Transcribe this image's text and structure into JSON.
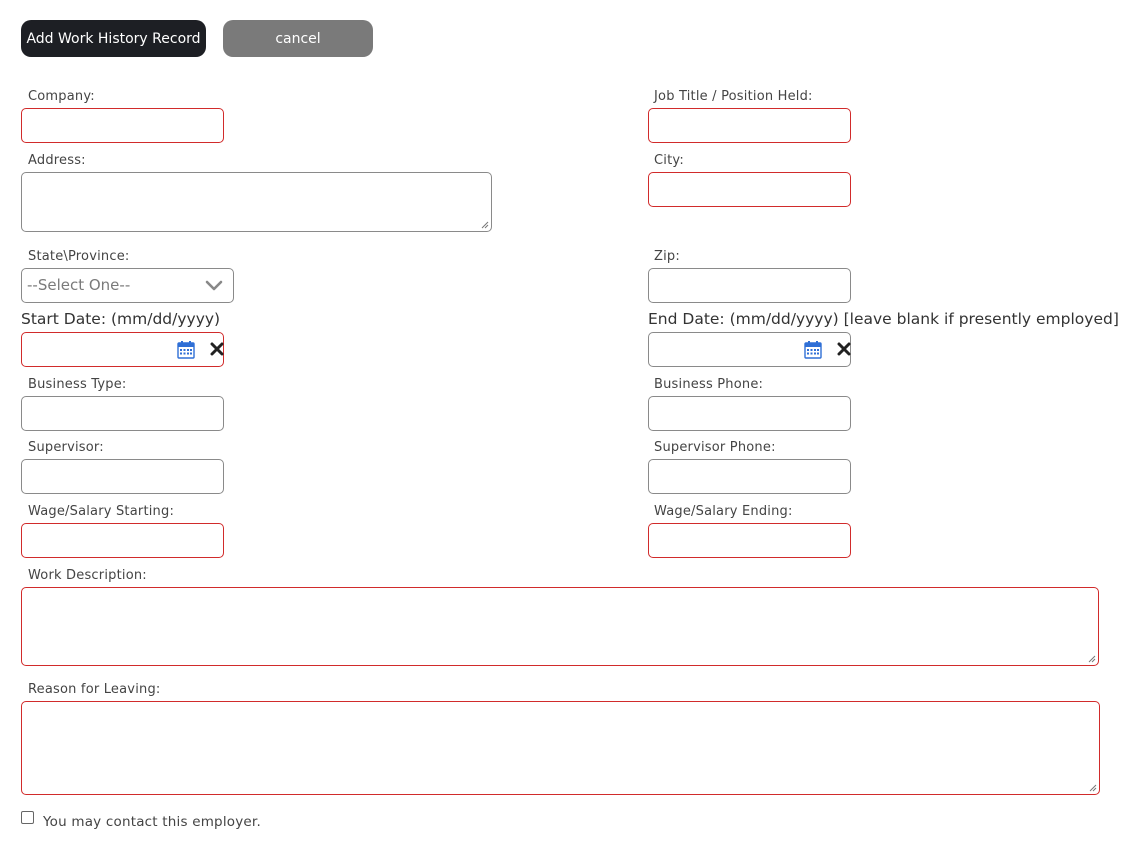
{
  "toolbar": {
    "add_label": "Add Work History Record",
    "cancel_label": "cancel"
  },
  "labels": {
    "company": "Company:",
    "job_title": "Job Title / Position Held:",
    "address": "Address:",
    "city": "City:",
    "state": "State\\Province:",
    "zip": "Zip:",
    "start_date": "Start Date: (mm/dd/yyyy)",
    "end_date": "End Date: (mm/dd/yyyy) [leave blank if presently employed]",
    "business_type": "Business Type:",
    "business_phone": "Business Phone:",
    "supervisor": "Supervisor:",
    "supervisor_phone": "Supervisor Phone:",
    "wage_start": "Wage/Salary Starting:",
    "wage_end": "Wage/Salary Ending:",
    "work_description": "Work Description:",
    "reason_leaving": "Reason for Leaving:",
    "contact_employer": "You may contact this employer."
  },
  "state_select": {
    "selected": "--Select One--"
  },
  "colors": {
    "required_border": "#d12b2b",
    "default_border": "#8a8a8a",
    "primary_button": "#1d1f24",
    "cancel_button": "#7a7a7a",
    "calendar_icon": "#2f6fd6"
  },
  "icons": {
    "calendar": "calendar-icon",
    "clear": "clear-x-icon",
    "dropdown": "chevron-down-icon"
  }
}
